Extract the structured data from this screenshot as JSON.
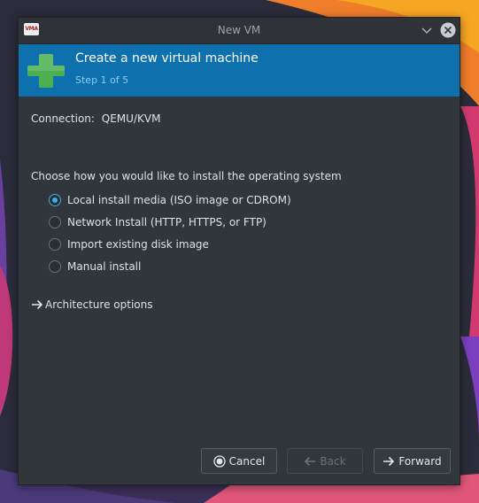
{
  "window": {
    "title": "New VM",
    "app_icon_text": "VMA",
    "app_icon": "virt-manager-icon",
    "minimize_icon": "chevron-down-icon",
    "close_icon": "close-icon"
  },
  "header": {
    "icon": "plus-icon",
    "title": "Create a new virtual machine",
    "step": "Step 1 of 5",
    "bg_color": "#0e70ad",
    "icon_color": "#4caf50"
  },
  "connection": {
    "label": "Connection:",
    "value": "QEMU/KVM"
  },
  "install": {
    "prompt": "Choose how you would like to install the operating system",
    "options": [
      {
        "label": "Local install media (ISO image or CDROM)",
        "selected": true
      },
      {
        "label": "Network Install (HTTP, HTTPS, or FTP)",
        "selected": false
      },
      {
        "label": "Import existing disk image",
        "selected": false
      },
      {
        "label": "Manual install",
        "selected": false
      }
    ]
  },
  "architecture": {
    "icon": "arrow-right-icon",
    "label": "Architecture options"
  },
  "buttons": {
    "cancel": {
      "label": "Cancel",
      "icon": "cancel-circle-icon",
      "enabled": true
    },
    "back": {
      "label": "Back",
      "icon": "arrow-left-icon",
      "enabled": false
    },
    "forward": {
      "label": "Forward",
      "icon": "arrow-right-icon",
      "enabled": true
    }
  },
  "colors": {
    "accent": "#3daee9",
    "window_bg": "#31363b"
  }
}
